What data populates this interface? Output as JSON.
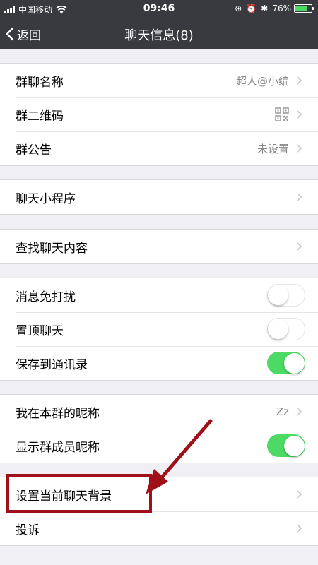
{
  "status": {
    "carrier": "中国移动",
    "time": "09:46",
    "battery": "76%",
    "battery_level": 0.76
  },
  "nav": {
    "back_label": "返回",
    "title": "聊天信息(8)"
  },
  "groups": {
    "info": {
      "name_label": "群聊名称",
      "name_value": "超人@小编",
      "qrcode_label": "群二维码",
      "notice_label": "群公告",
      "notice_value": "未设置"
    },
    "mini_program": {
      "label": "聊天小程序"
    },
    "search": {
      "label": "查找聊天内容"
    },
    "toggles": {
      "mute_label": "消息免打扰",
      "mute_on": false,
      "sticky_label": "置顶聊天",
      "sticky_on": false,
      "save_label": "保存到通讯录",
      "save_on": true
    },
    "nickname": {
      "my_nickname_label": "我在本群的昵称",
      "my_nickname_value": "Zz",
      "show_nickname_label": "显示群成员昵称",
      "show_nickname_on": true
    },
    "background": {
      "background_label": "设置当前聊天背景",
      "report_label": "投诉"
    }
  },
  "colors": {
    "nav_bg": "#393a3f",
    "toggle_on": "#4cd964",
    "annotation": "#a01018"
  }
}
